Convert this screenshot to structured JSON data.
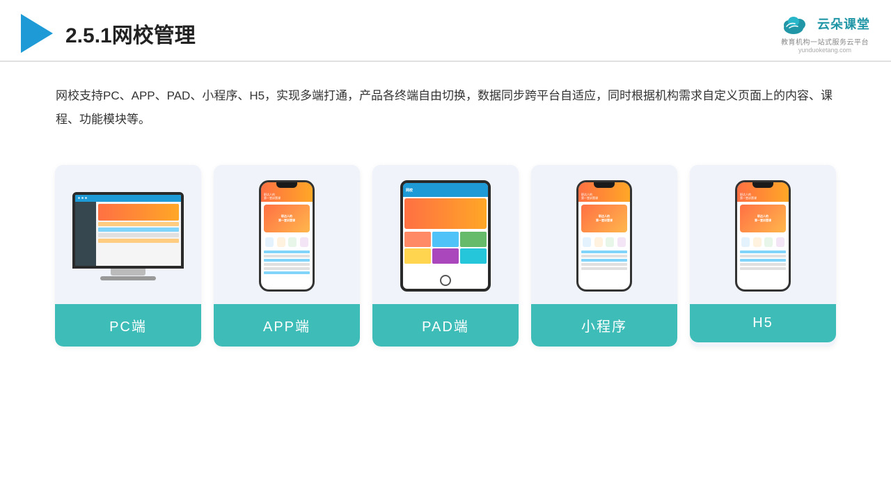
{
  "header": {
    "title_prefix": "2.5.1",
    "title_main": "网校管理",
    "logo_main": "云朵课堂",
    "logo_sub": "教育机构一站\n式服务云平台",
    "logo_domain": "yunduoketang.com"
  },
  "description": {
    "text": "网校支持PC、APP、PAD、小程序、H5，实现多端打通，产品各终端自由切换，数据同步跨平台自适应，同时根据机构需求自定义页面上的内容、课程、功能模块等。"
  },
  "cards": [
    {
      "id": "pc",
      "label": "PC端"
    },
    {
      "id": "app",
      "label": "APP端"
    },
    {
      "id": "pad",
      "label": "PAD端"
    },
    {
      "id": "mini",
      "label": "小程序"
    },
    {
      "id": "h5",
      "label": "H5"
    }
  ]
}
